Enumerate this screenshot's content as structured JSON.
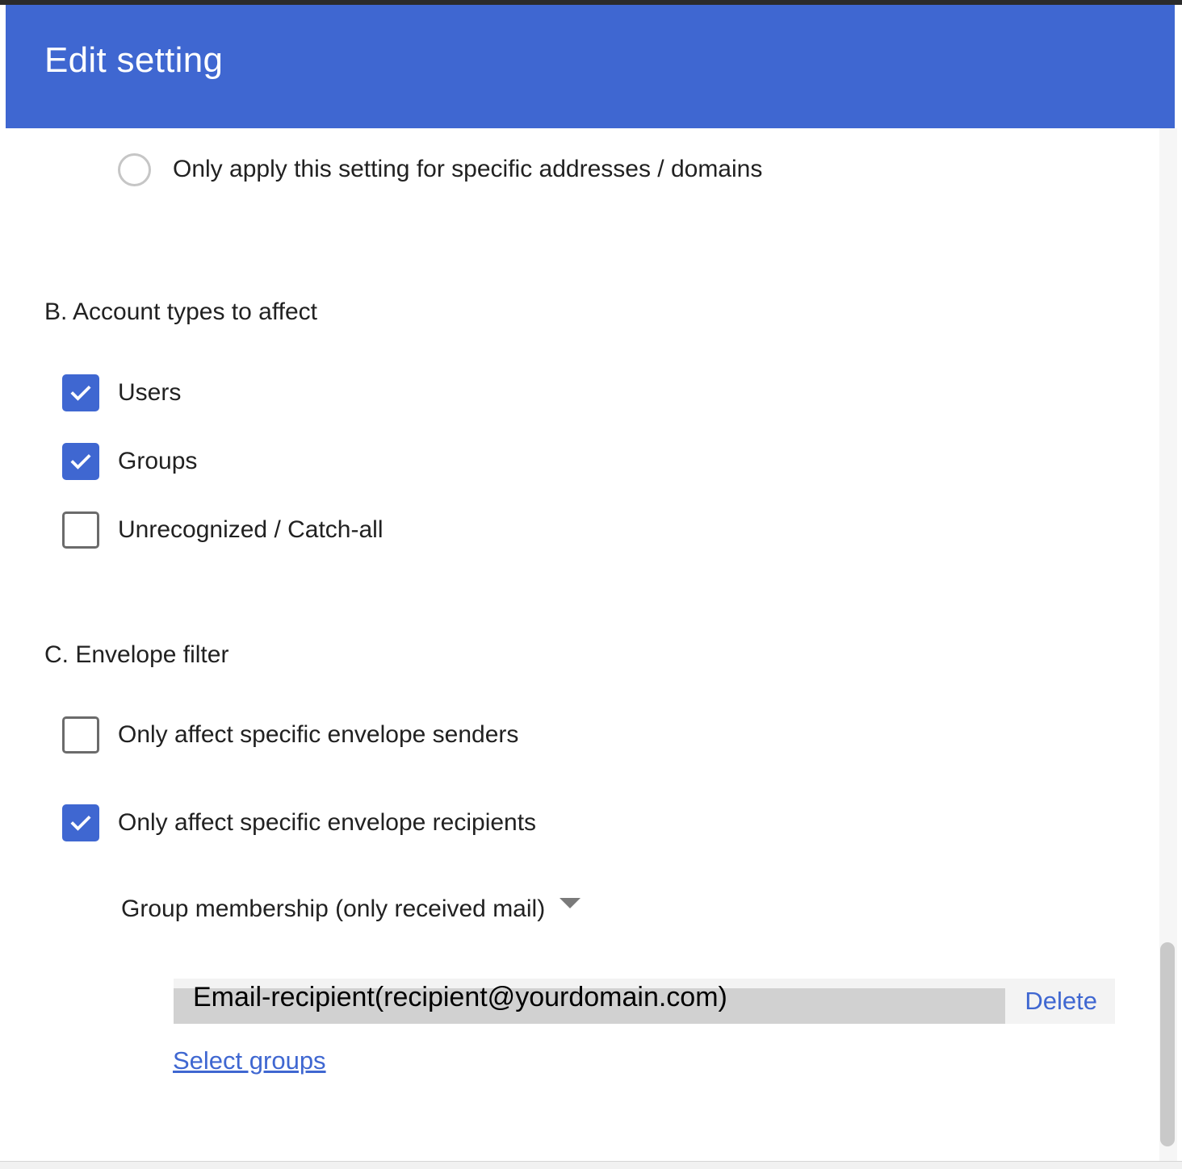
{
  "header": {
    "title": "Edit setting"
  },
  "scope": {
    "radio_label": "Only apply this setting for specific addresses / domains",
    "selected": false
  },
  "account_types": {
    "title": "B. Account types to affect",
    "options": [
      {
        "label": "Users",
        "checked": true
      },
      {
        "label": "Groups",
        "checked": true
      },
      {
        "label": "Unrecognized / Catch-all",
        "checked": false
      }
    ]
  },
  "envelope_filter": {
    "title": "C. Envelope filter",
    "senders": {
      "label": "Only affect specific envelope senders",
      "checked": false
    },
    "recipients": {
      "label": "Only affect specific envelope recipients",
      "checked": true
    },
    "dropdown": {
      "selected": "Group membership (only received mail)"
    },
    "group_entry": {
      "text": "Email-recipient(recipient@yourdomain.com)",
      "delete_label": "Delete"
    },
    "select_groups_label": "Select groups"
  },
  "colors": {
    "accent": "#3f67d1",
    "header_bg": "#3f67d1",
    "checkbox_border": "#6b6b6b"
  }
}
